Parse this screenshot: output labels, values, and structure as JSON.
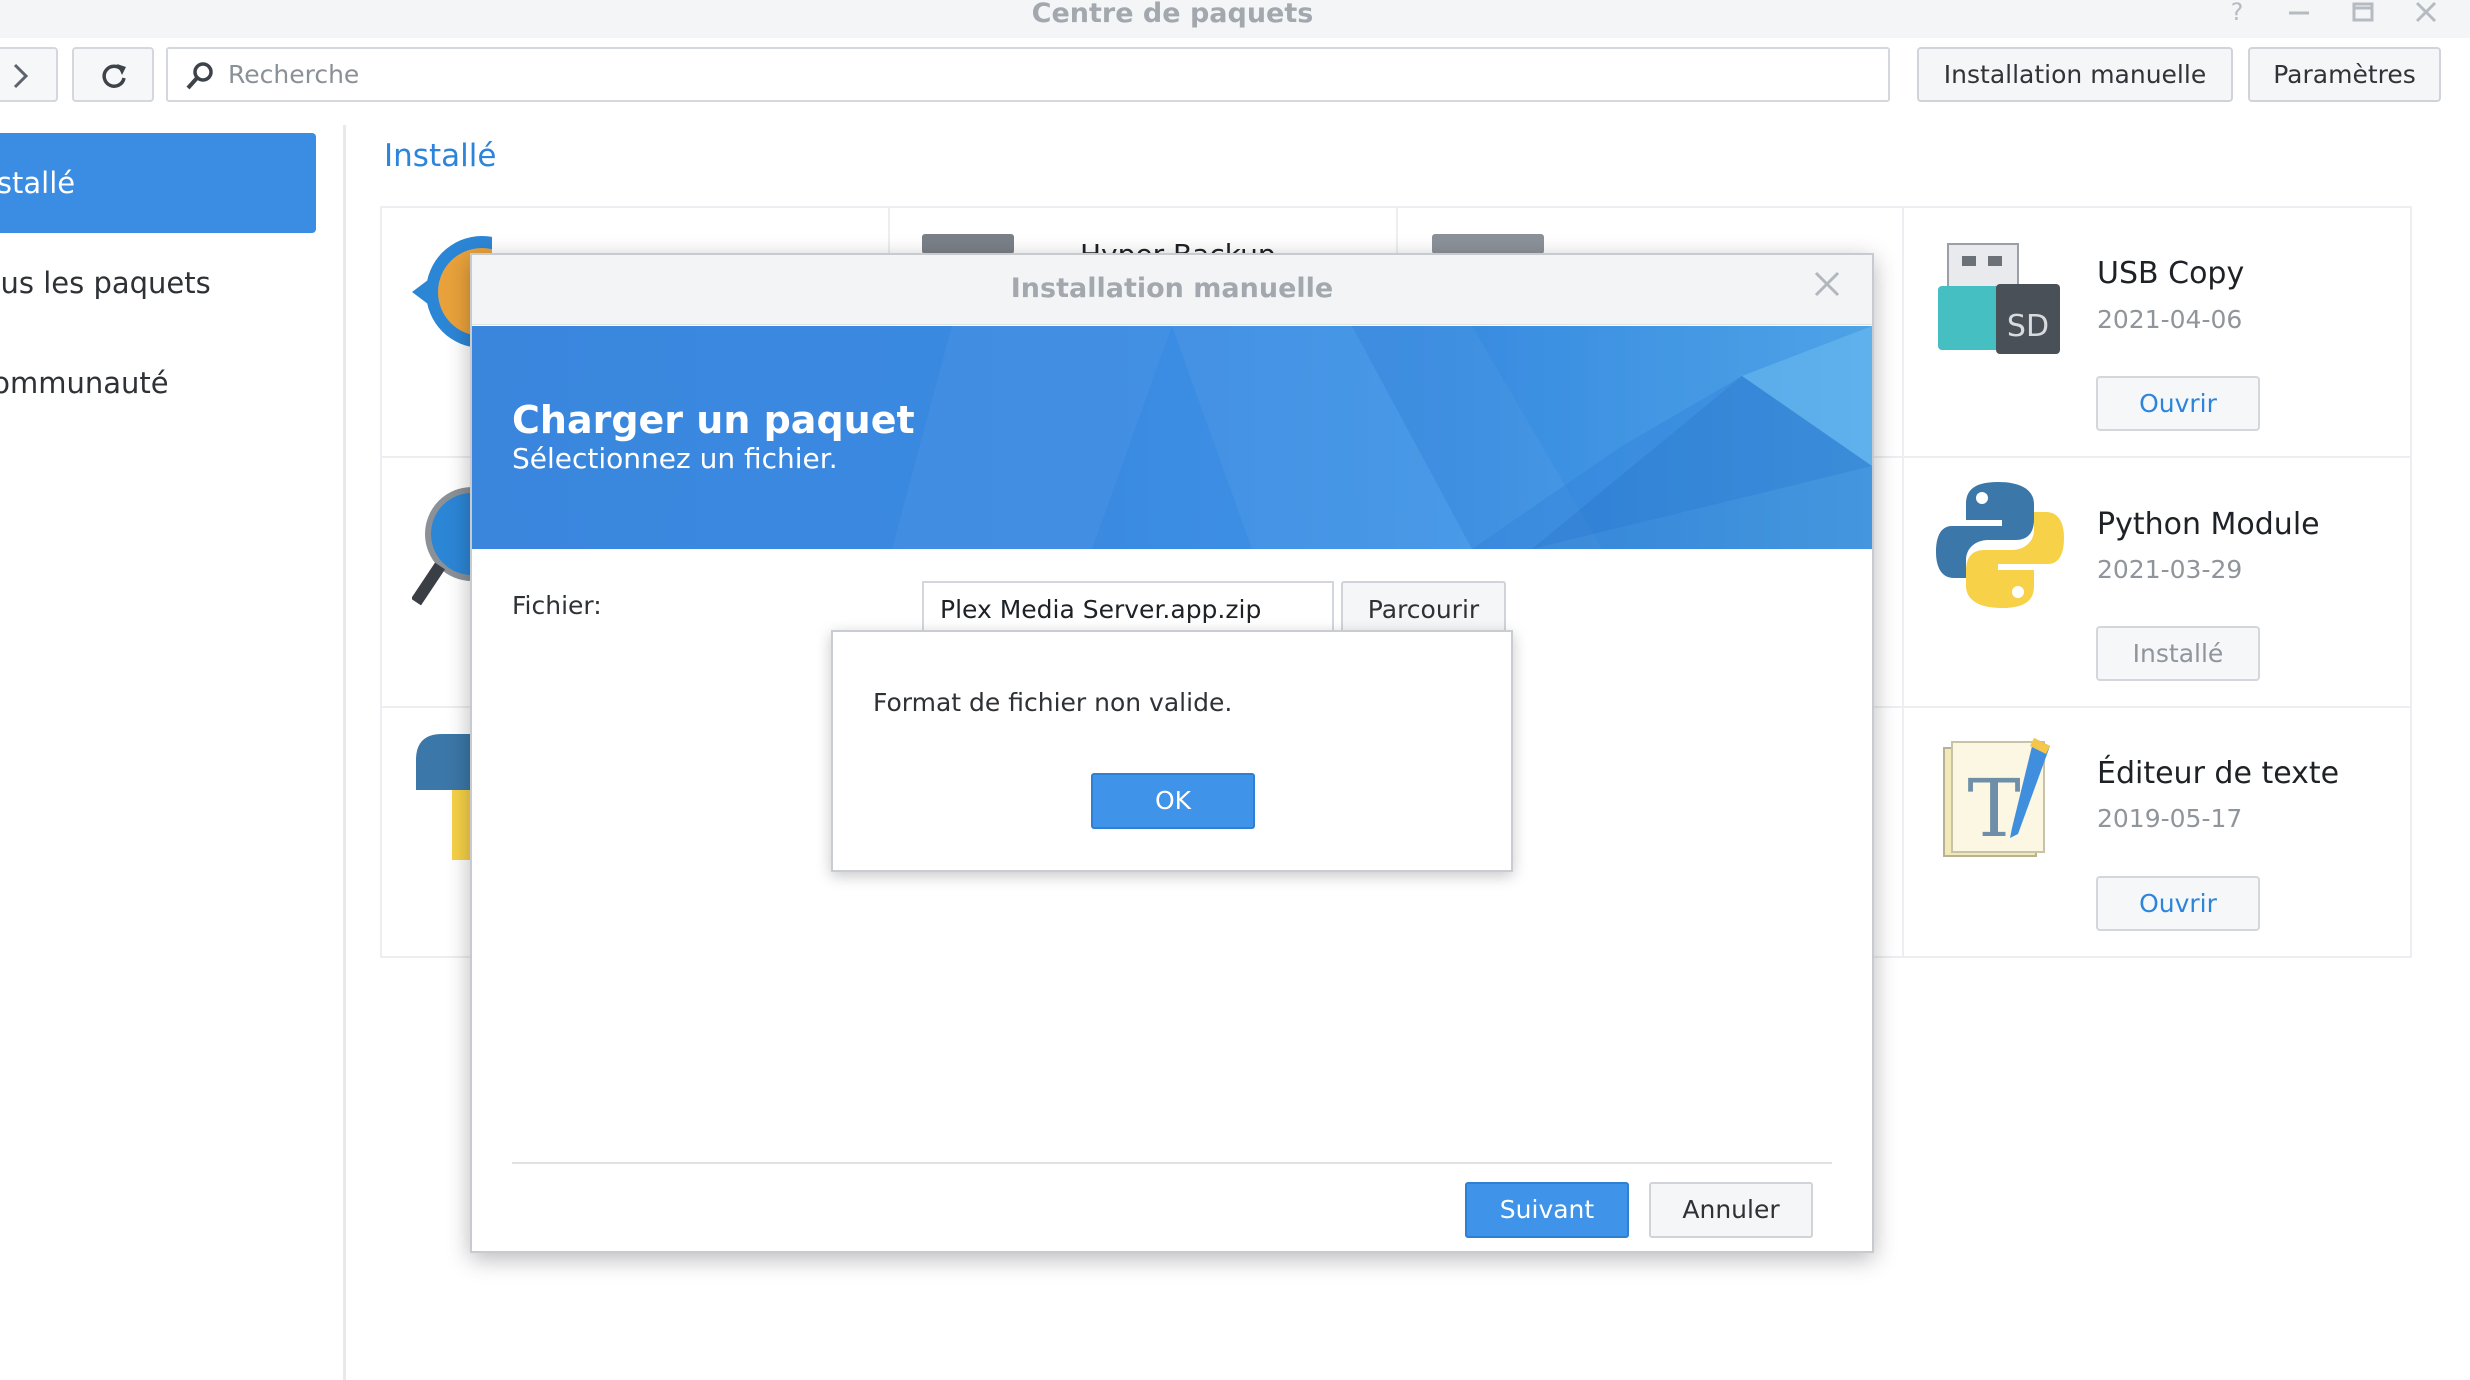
{
  "window": {
    "title": "Centre de paquets",
    "controls": [
      "help-icon",
      "minimize-icon",
      "maximize-icon",
      "close-icon"
    ]
  },
  "toolbar": {
    "search_placeholder": "Recherche",
    "manual_install_label": "Installation manuelle",
    "settings_label": "Paramètres"
  },
  "sidebar": {
    "items": [
      {
        "label": "Installé",
        "active": true
      },
      {
        "label": "Tous les paquets",
        "active": false
      },
      {
        "label": "Communauté",
        "active": false
      }
    ]
  },
  "main": {
    "section_title": "Installé",
    "partial_package_name": "Hyper Backup",
    "packages": [
      {
        "name": "USB Copy",
        "date": "2021-04-06",
        "action": "Ouvrir",
        "action_enabled": true,
        "icon": "usb-sd-icon"
      },
      {
        "name": "Python Module",
        "date": "2021-03-29",
        "action": "Installé",
        "action_enabled": false,
        "icon": "python-icon"
      },
      {
        "name": "Éditeur de texte",
        "date": "2019-05-17",
        "action": "Ouvrir",
        "action_enabled": true,
        "icon": "text-editor-icon"
      }
    ]
  },
  "dialog": {
    "title": "Installation manuelle",
    "banner_title": "Charger un paquet",
    "banner_subtitle": "Sélectionnez un fichier.",
    "file_label": "Fichier:",
    "file_value": "Plex Media Server.app.zip",
    "browse_label": "Parcourir",
    "next_label": "Suivant",
    "cancel_label": "Annuler"
  },
  "alert": {
    "message": "Format de fichier non valide.",
    "ok_label": "OK"
  },
  "colors": {
    "accent": "#3b8ce3",
    "link": "#2d85db",
    "title_gray": "#a3a8ae"
  }
}
